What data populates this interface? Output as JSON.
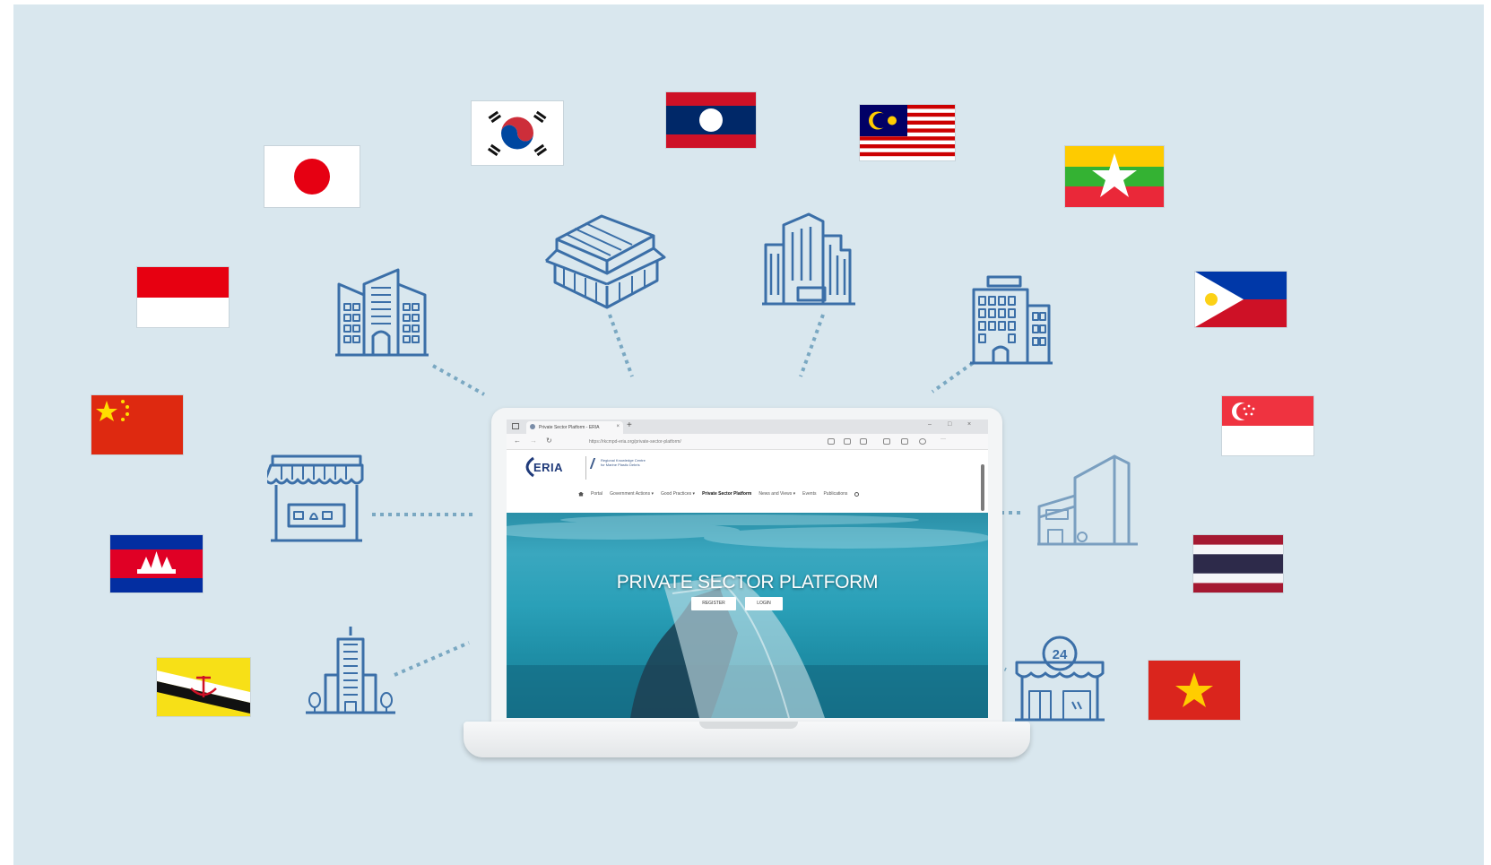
{
  "browser": {
    "tab_title": "Private Sector Platform - ERIA",
    "tab_close": "×",
    "new_tab": "+",
    "url": "https://rkcmpd-eria.org/private-sector-platform/",
    "minimize": "–",
    "maximize": "□",
    "close": "×",
    "back": "←",
    "forward": "→",
    "reload": "↻"
  },
  "site": {
    "logo": "ERIA",
    "partner_logo_line1": "Regional Knowledge Centre",
    "partner_logo_line2": "for Marine Plastic Debris",
    "nav": [
      {
        "label": "Portal"
      },
      {
        "label": "Government Actions ▾"
      },
      {
        "label": "Good Practices ▾"
      },
      {
        "label": "Private Sector Platform",
        "active": true
      },
      {
        "label": "News and Views ▾"
      },
      {
        "label": "Events"
      },
      {
        "label": "Publications"
      }
    ],
    "search_icon": "search-icon",
    "hero": {
      "title": "PRIVATE SECTOR PLATFORM",
      "register_label": "REGISTER",
      "login_label": "LOGIN"
    }
  },
  "flags": [
    "Japan",
    "South Korea",
    "Laos",
    "Malaysia",
    "Myanmar",
    "Indonesia",
    "Philippines",
    "China",
    "Singapore",
    "Cambodia",
    "Thailand",
    "Brunei",
    "Vietnam"
  ],
  "buildings": [
    "office-towers-icon",
    "exhibition-hall-icon",
    "skyscraper-icon",
    "hotel-icon",
    "market-stall-icon",
    "store-building-icon",
    "tall-tower-icon",
    "convenience-store-24-icon"
  ],
  "colors": {
    "background": "#d9e7ee",
    "icon_stroke": "#3b6fa8",
    "connector": "#7fa9c3"
  }
}
